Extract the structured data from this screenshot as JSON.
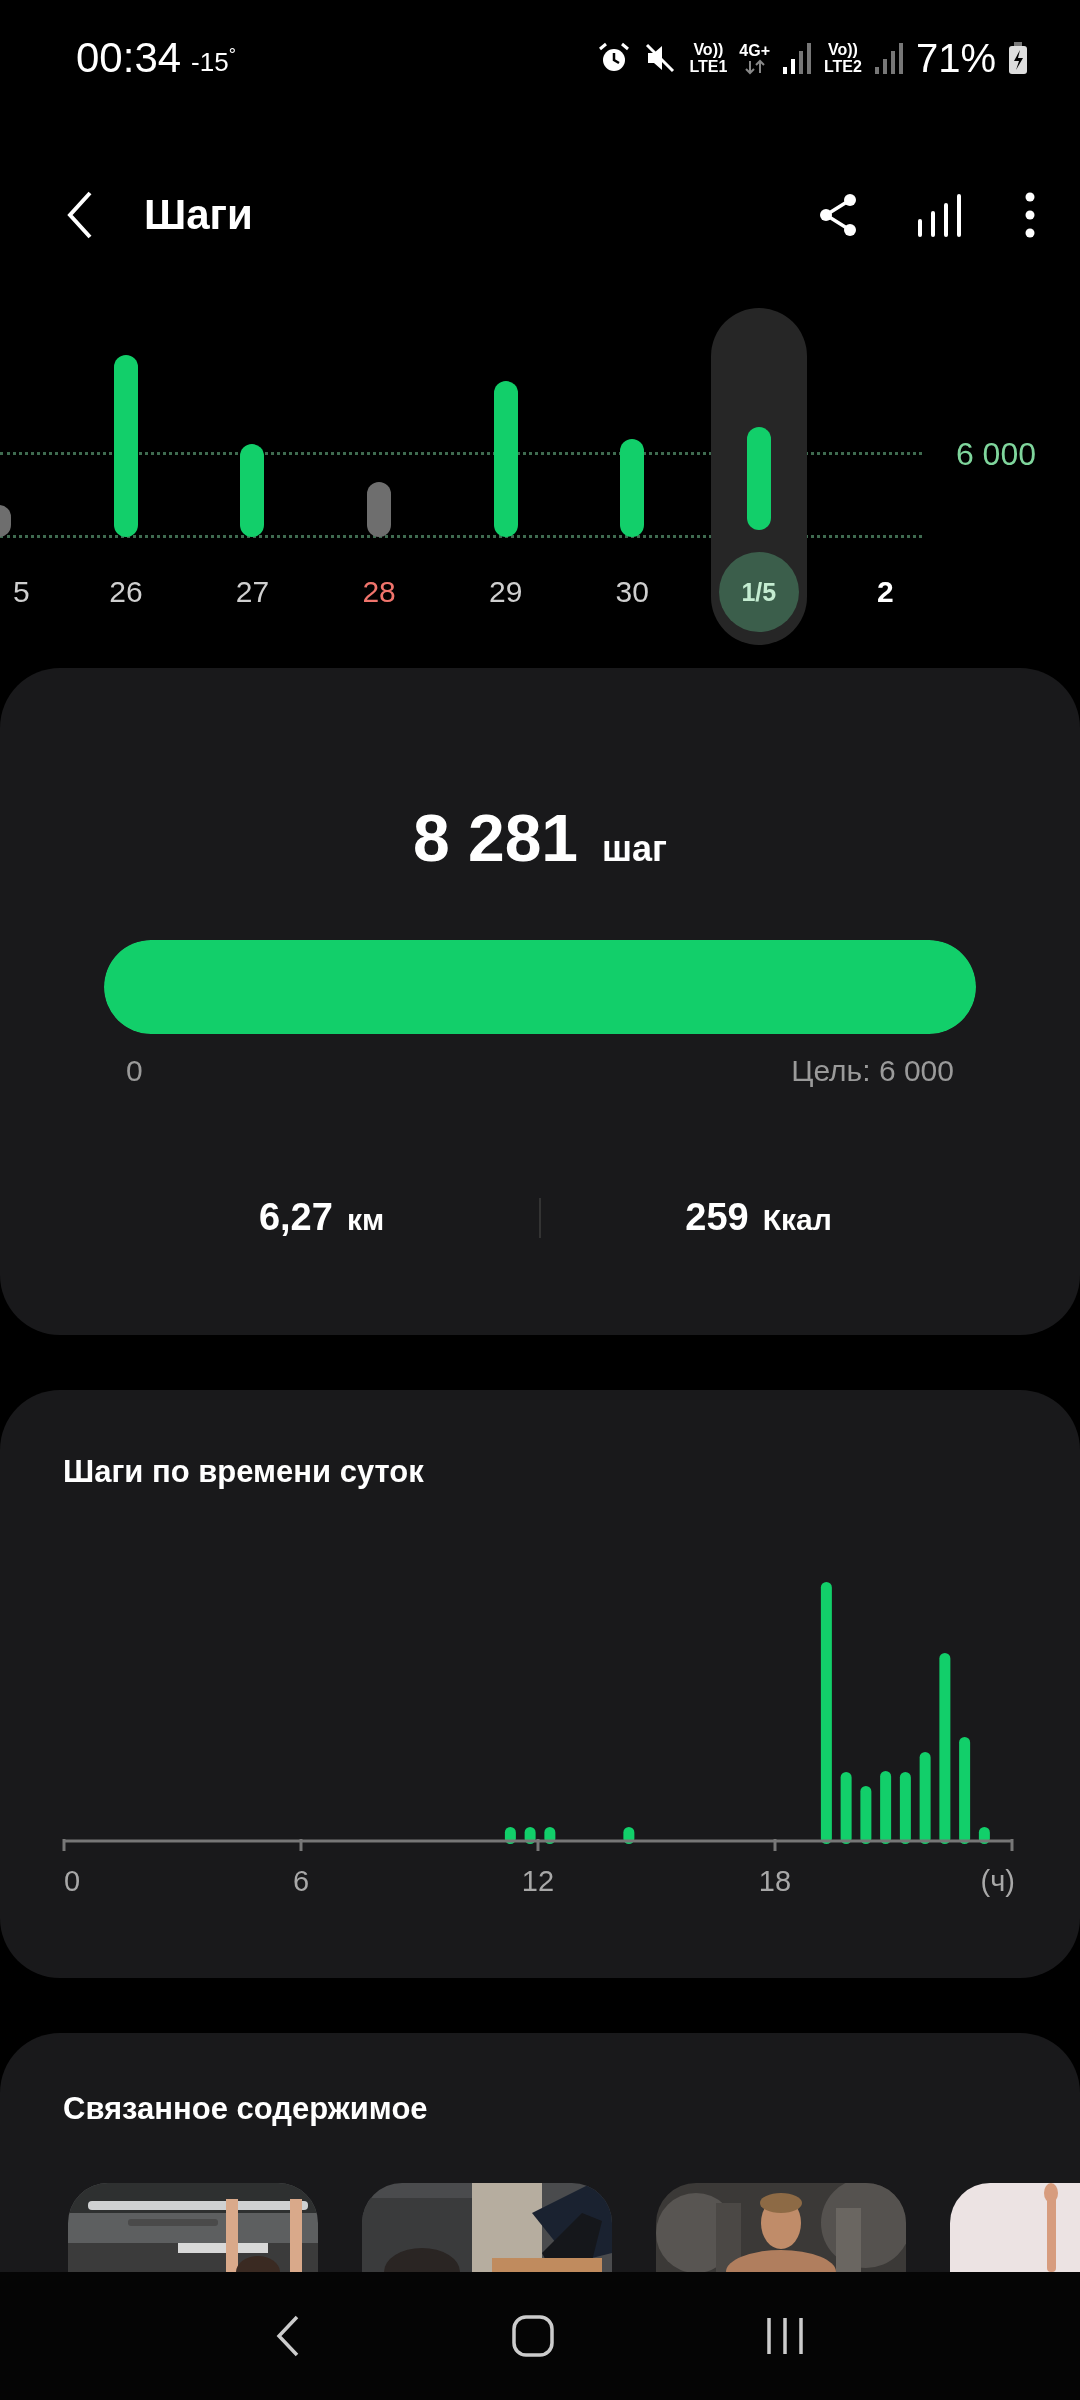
{
  "status_bar": {
    "time": "00:34",
    "temperature": "-15$^{°}$",
    "sim_1": {
      "volte": "Vo))",
      "network": "LTE1"
    },
    "data": "4G+",
    "sim_2": {
      "volte": "Vo))",
      "network": "LTE2"
    },
    "battery": "71%"
  },
  "header": {
    "title": "Шаги"
  },
  "week_chart": {
    "goal_label": "6 000",
    "days": [
      {
        "label": "5",
        "selected": false,
        "weekend": false,
        "today": false,
        "color": "#6e6e6e"
      },
      {
        "label": "26",
        "selected": false,
        "weekend": false,
        "today": false,
        "color": "#12cf6a"
      },
      {
        "label": "27",
        "selected": false,
        "weekend": false,
        "today": false,
        "color": "#12cf6a"
      },
      {
        "label": "28",
        "selected": false,
        "weekend": true,
        "today": false,
        "color": "#6e6e6e"
      },
      {
        "label": "29",
        "selected": false,
        "weekend": false,
        "today": false,
        "color": "#12cf6a"
      },
      {
        "label": "30",
        "selected": false,
        "weekend": false,
        "today": false,
        "color": "#12cf6a"
      },
      {
        "label": "1/5",
        "selected": true,
        "weekend": false,
        "today": false,
        "color": "#12cf6a"
      },
      {
        "label": "2",
        "selected": false,
        "weekend": false,
        "today": true
      }
    ]
  },
  "summary": {
    "steps": "8 281",
    "unit": "шаг",
    "level": 1,
    "min_label": "0",
    "goal_label": "Цель: 6 000",
    "distance": {
      "value": "6,27",
      "unit": "км"
    },
    "calories": {
      "value": "259",
      "unit": "Ккал"
    }
  },
  "hourly": {
    "title": "Шаги по времени суток",
    "x_labels": [
      "0",
      "6",
      "12",
      "18"
    ],
    "unit_label": "(ч)"
  },
  "related": {
    "title": "Связанное содержимое"
  }
}
